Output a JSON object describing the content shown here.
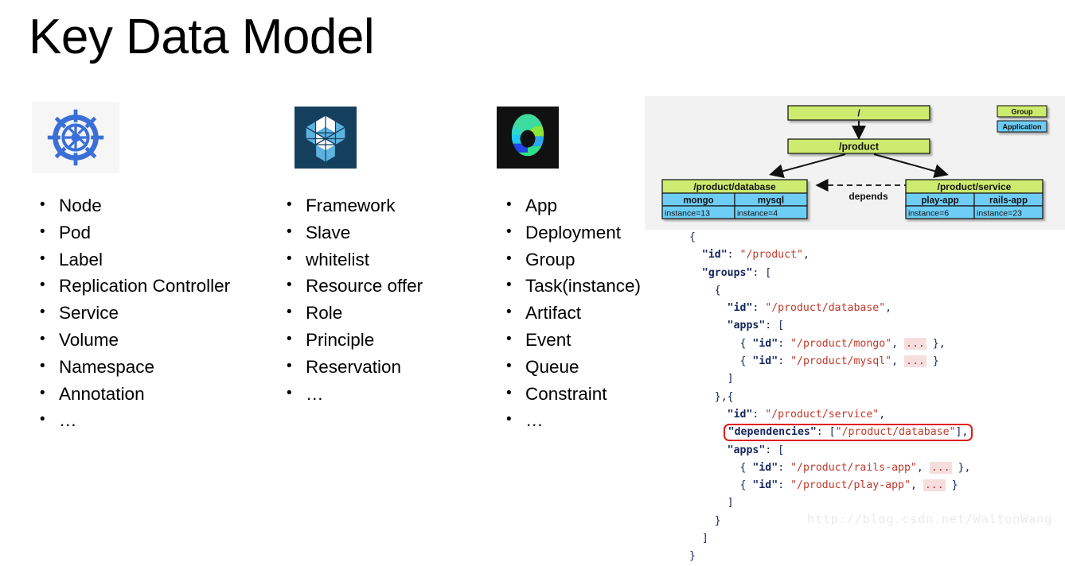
{
  "slide": {
    "title": "Key Data Model",
    "watermark": "http://blog.csdn.net/WaltonWang"
  },
  "columns": [
    {
      "logo": "kubernetes-logo",
      "logo_label": "Kubernetes",
      "items": [
        "Node",
        "Pod",
        "Label",
        "Replication Controller",
        "Service",
        "Volume",
        "Namespace",
        "Annotation",
        "…"
      ]
    },
    {
      "logo": "apache-mesos-logo",
      "logo_label": "Apache Mesos",
      "items": [
        "Framework",
        "Slave",
        "whitelist",
        "Resource offer",
        "Role",
        "Principle",
        "Reservation",
        "…"
      ]
    },
    {
      "logo": "marathon-logo",
      "logo_label": "Marathon",
      "items": [
        "App",
        "Deployment",
        "Group",
        "Task(instance)",
        "Artifact",
        "Event",
        "Queue",
        "Constraint",
        "…"
      ]
    }
  ],
  "diagram": {
    "legend": [
      {
        "label": "Group",
        "color": "#cdeb6e"
      },
      {
        "label": "Application",
        "color": "#6ecdf5"
      }
    ],
    "root": "/",
    "product": "/product",
    "depends_label": "depends",
    "groups": [
      {
        "name": "/product/database",
        "apps": [
          {
            "name": "mongo",
            "instances": "instance=13"
          },
          {
            "name": "mysql",
            "instances": "instance=4"
          }
        ]
      },
      {
        "name": "/product/service",
        "apps": [
          {
            "name": "play-app",
            "instances": "instance=6"
          },
          {
            "name": "rails-app",
            "instances": "instance=23"
          }
        ]
      }
    ],
    "colors": {
      "group": "#cdeb6e",
      "application": "#6ecdf5",
      "panel_bg": "#f2f2f2",
      "border": "#1a1a1a"
    }
  },
  "json_code": {
    "lines": [
      {
        "indent": 0,
        "parts": [
          {
            "t": "{",
            "c": "p"
          }
        ]
      },
      {
        "indent": 2,
        "parts": [
          {
            "t": "\"id\"",
            "c": "k"
          },
          {
            "t": ": ",
            "c": "p"
          },
          {
            "t": "\"/product\"",
            "c": "s"
          },
          {
            "t": ",",
            "c": "p"
          }
        ]
      },
      {
        "indent": 2,
        "parts": [
          {
            "t": "\"groups\"",
            "c": "k"
          },
          {
            "t": ": [",
            "c": "p"
          }
        ]
      },
      {
        "indent": 4,
        "parts": [
          {
            "t": "{",
            "c": "p"
          }
        ]
      },
      {
        "indent": 6,
        "parts": [
          {
            "t": "\"id\"",
            "c": "k"
          },
          {
            "t": ": ",
            "c": "p"
          },
          {
            "t": "\"/product/database\"",
            "c": "s"
          },
          {
            "t": ",",
            "c": "p"
          }
        ]
      },
      {
        "indent": 6,
        "parts": [
          {
            "t": "\"apps\"",
            "c": "k"
          },
          {
            "t": ": [",
            "c": "p"
          }
        ]
      },
      {
        "indent": 8,
        "parts": [
          {
            "t": "{ ",
            "c": "p"
          },
          {
            "t": "\"id\"",
            "c": "k"
          },
          {
            "t": ": ",
            "c": "p"
          },
          {
            "t": "\"/product/mongo\"",
            "c": "s"
          },
          {
            "t": ", ",
            "c": "p"
          },
          {
            "t": "...",
            "c": "e"
          },
          {
            "t": " }",
            "c": "p"
          },
          {
            "t": ",",
            "c": "p"
          }
        ]
      },
      {
        "indent": 8,
        "parts": [
          {
            "t": "{ ",
            "c": "p"
          },
          {
            "t": "\"id\"",
            "c": "k"
          },
          {
            "t": ": ",
            "c": "p"
          },
          {
            "t": "\"/product/mysql\"",
            "c": "s"
          },
          {
            "t": ", ",
            "c": "p"
          },
          {
            "t": "...",
            "c": "e"
          },
          {
            "t": " }",
            "c": "p"
          }
        ]
      },
      {
        "indent": 6,
        "parts": [
          {
            "t": "]",
            "c": "p"
          }
        ]
      },
      {
        "indent": 4,
        "parts": [
          {
            "t": "},{",
            "c": "p"
          }
        ]
      },
      {
        "indent": 6,
        "parts": [
          {
            "t": "\"id\"",
            "c": "k"
          },
          {
            "t": ": ",
            "c": "p"
          },
          {
            "t": "\"/product/service\"",
            "c": "s"
          },
          {
            "t": ",",
            "c": "p"
          }
        ]
      },
      {
        "indent": 6,
        "highlight": true,
        "parts": [
          {
            "t": "\"dependencies\"",
            "c": "k"
          },
          {
            "t": ": [",
            "c": "p"
          },
          {
            "t": "\"/product/database\"",
            "c": "s"
          },
          {
            "t": "],",
            "c": "p"
          }
        ]
      },
      {
        "indent": 6,
        "parts": [
          {
            "t": "\"apps\"",
            "c": "k"
          },
          {
            "t": ": [",
            "c": "p"
          }
        ]
      },
      {
        "indent": 8,
        "parts": [
          {
            "t": "{ ",
            "c": "p"
          },
          {
            "t": "\"id\"",
            "c": "k"
          },
          {
            "t": ": ",
            "c": "p"
          },
          {
            "t": "\"/product/rails-app\"",
            "c": "s"
          },
          {
            "t": ", ",
            "c": "p"
          },
          {
            "t": "...",
            "c": "e"
          },
          {
            "t": " }",
            "c": "p"
          },
          {
            "t": ",",
            "c": "p"
          }
        ]
      },
      {
        "indent": 8,
        "parts": [
          {
            "t": "{ ",
            "c": "p"
          },
          {
            "t": "\"id\"",
            "c": "k"
          },
          {
            "t": ": ",
            "c": "p"
          },
          {
            "t": "\"/product/play-app\"",
            "c": "s"
          },
          {
            "t": ", ",
            "c": "p"
          },
          {
            "t": "...",
            "c": "e"
          },
          {
            "t": " }",
            "c": "p"
          }
        ]
      },
      {
        "indent": 6,
        "parts": [
          {
            "t": "]",
            "c": "p"
          }
        ]
      },
      {
        "indent": 4,
        "parts": [
          {
            "t": "}",
            "c": "p"
          }
        ]
      },
      {
        "indent": 2,
        "parts": [
          {
            "t": "]",
            "c": "p"
          }
        ]
      },
      {
        "indent": 0,
        "parts": [
          {
            "t": "}",
            "c": "p"
          }
        ]
      }
    ]
  }
}
